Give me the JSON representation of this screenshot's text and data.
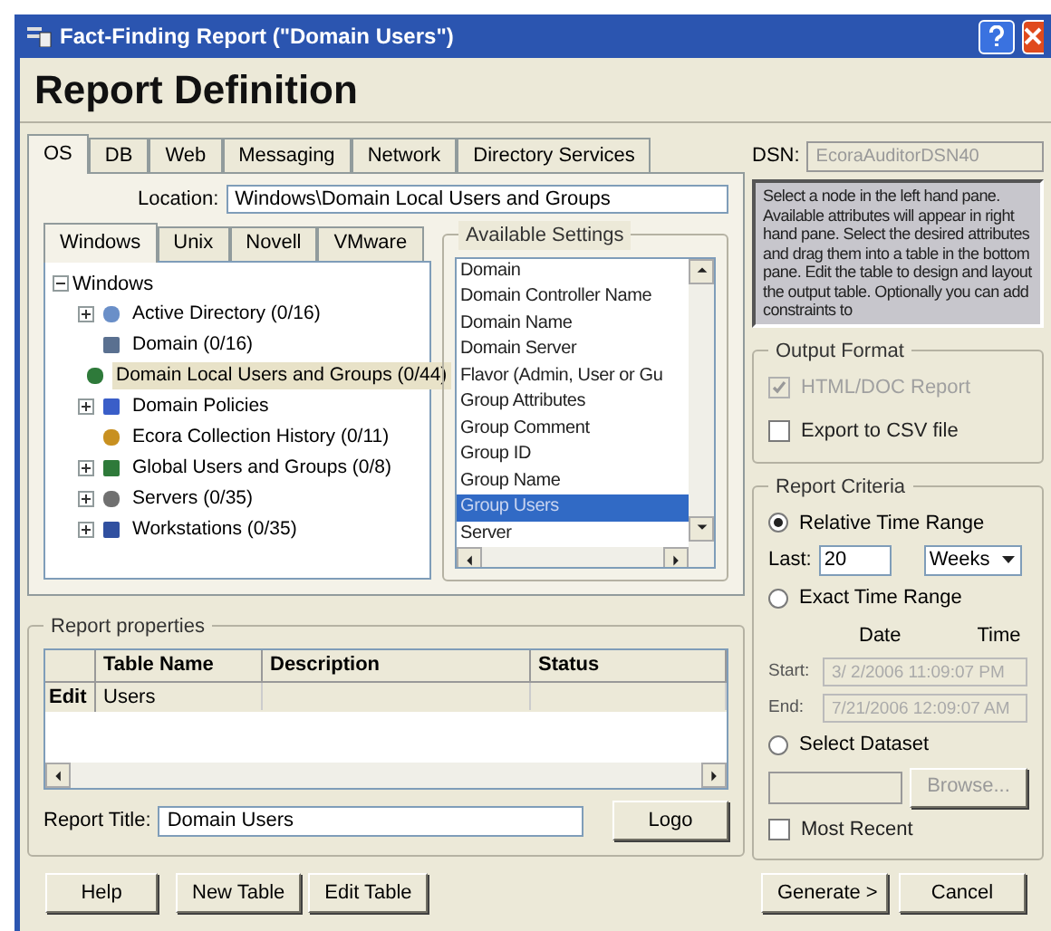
{
  "window": {
    "title": "Fact-Finding Report (\"Domain Users\")",
    "header": "Report Definition"
  },
  "tabs": [
    {
      "label": "OS",
      "selected": true
    },
    {
      "label": "DB",
      "selected": false
    },
    {
      "label": "Web",
      "selected": false
    },
    {
      "label": "Messaging",
      "selected": false
    },
    {
      "label": "Network",
      "selected": false
    },
    {
      "label": "Directory Services",
      "selected": false
    }
  ],
  "location": {
    "label": "Location:",
    "value": "Windows\\Domain Local Users and Groups"
  },
  "platform_tabs": [
    {
      "label": "Windows",
      "selected": true
    },
    {
      "label": "Unix",
      "selected": false
    },
    {
      "label": "Novell",
      "selected": false
    },
    {
      "label": "VMware",
      "selected": false
    }
  ],
  "tree": {
    "label": "Windows",
    "expanded": true,
    "children": [
      {
        "label": "Active Directory (0/16)",
        "expandable": true,
        "selected": false
      },
      {
        "label": "Domain (0/16)",
        "expandable": false,
        "selected": false
      },
      {
        "label": "Domain Local Users and Groups (0/44)",
        "expandable": false,
        "selected": true
      },
      {
        "label": "Domain Policies",
        "expandable": true,
        "selected": false
      },
      {
        "label": "Ecora Collection History (0/11)",
        "expandable": false,
        "selected": false
      },
      {
        "label": "Global Users and Groups (0/8)",
        "expandable": true,
        "selected": false
      },
      {
        "label": "Servers (0/35)",
        "expandable": true,
        "selected": false
      },
      {
        "label": "Workstations (0/35)",
        "expandable": true,
        "selected": false
      }
    ]
  },
  "available_settings": {
    "title": "Available Settings",
    "items": [
      {
        "label": "Domain",
        "selected": false
      },
      {
        "label": "Domain Controller Name",
        "selected": false
      },
      {
        "label": "Domain Name",
        "selected": false
      },
      {
        "label": "Domain Server",
        "selected": false
      },
      {
        "label": "Flavor (Admin, User or Gu",
        "selected": false
      },
      {
        "label": "Group Attributes",
        "selected": false
      },
      {
        "label": "Group Comment",
        "selected": false
      },
      {
        "label": "Group ID",
        "selected": false
      },
      {
        "label": "Group Name",
        "selected": false
      },
      {
        "label": "Group Users",
        "selected": true
      },
      {
        "label": "Server",
        "selected": false
      }
    ]
  },
  "report_properties": {
    "title": "Report properties",
    "columns": [
      "Table Name",
      "Description",
      "Status"
    ],
    "rows": [
      {
        "header": "Edit",
        "cells": [
          "Users",
          "",
          ""
        ]
      }
    ],
    "title_label": "Report Title:",
    "title_value": "Domain Users",
    "logo_button": "Logo"
  },
  "dsn": {
    "label": "DSN:",
    "value": "EcoraAuditorDSN40"
  },
  "help_text": "Select a node in the left hand pane. Available attributes will appear in right hand pane. Select the desired attributes and drag them into a table in the bottom pane. Edit the table to design and layout the output table. Optionally you can add constraints to",
  "output_format": {
    "title": "Output Format",
    "options": [
      {
        "label": "HTML/DOC Report",
        "checked": true,
        "disabled": true
      },
      {
        "label": "Export to CSV file",
        "checked": false,
        "disabled": false
      }
    ]
  },
  "report_criteria": {
    "title": "Report Criteria",
    "relative": {
      "label": "Relative Time Range",
      "selected": true
    },
    "last_label": "Last:",
    "last_value": "20",
    "unit": "Weeks",
    "exact": {
      "label": "Exact Time Range",
      "selected": false
    },
    "date_header": "Date",
    "time_header": "Time",
    "start_label": "Start:",
    "start_value": "3/ 2/2006 11:09:07 PM",
    "end_label": "End:",
    "end_value": "7/21/2006 12:09:07 AM",
    "dataset": {
      "label": "Select Dataset",
      "selected": false
    },
    "browse_button": "Browse...",
    "most_recent": {
      "label": "Most Recent",
      "checked": false
    }
  },
  "footer_buttons": [
    "Help",
    "New Table",
    "Edit Table"
  ],
  "action_buttons": [
    "Generate >",
    "Cancel"
  ]
}
